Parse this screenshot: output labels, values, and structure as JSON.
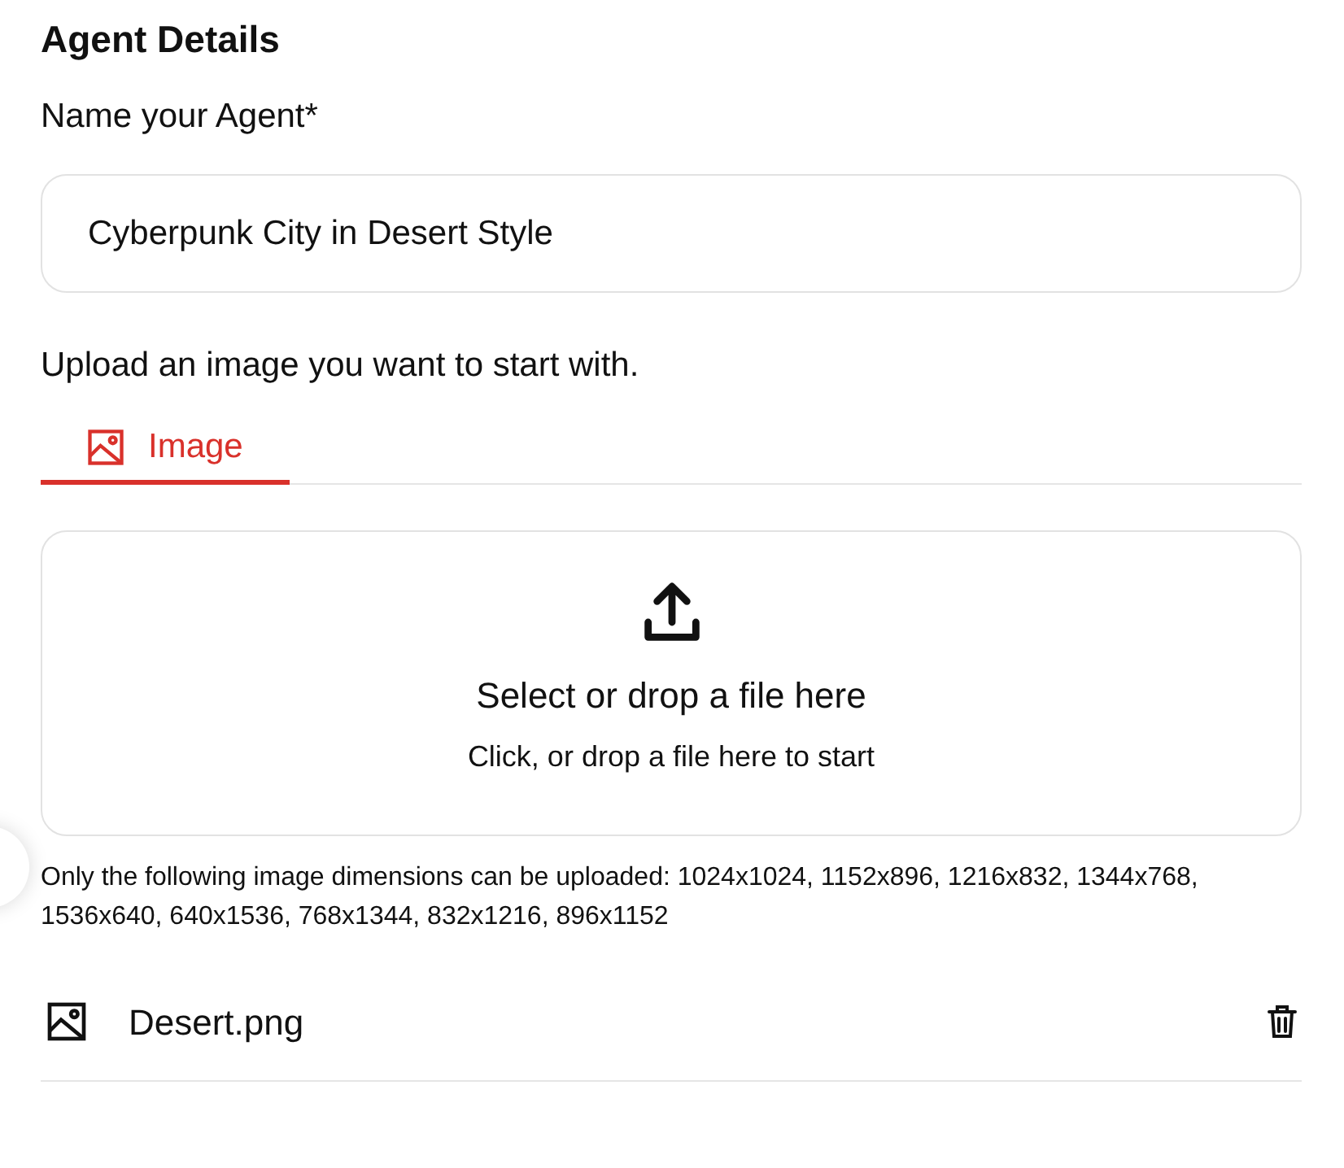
{
  "heading": "Agent Details",
  "name_field": {
    "label": "Name your Agent*",
    "value": "Cyberpunk City in Desert Style"
  },
  "upload_prompt": "Upload an image you want to start with.",
  "tabs": [
    {
      "label": "Image",
      "selected": true
    }
  ],
  "dropzone": {
    "title": "Select or drop a file here",
    "subtitle": "Click, or drop a file here to start"
  },
  "hint": "Only the following image dimensions can be uploaded: 1024x1024, 1152x896, 1216x832, 1344x768, 1536x640, 640x1536, 768x1344, 832x1216, 896x1152",
  "files": [
    {
      "name": "Desert.png"
    }
  ]
}
